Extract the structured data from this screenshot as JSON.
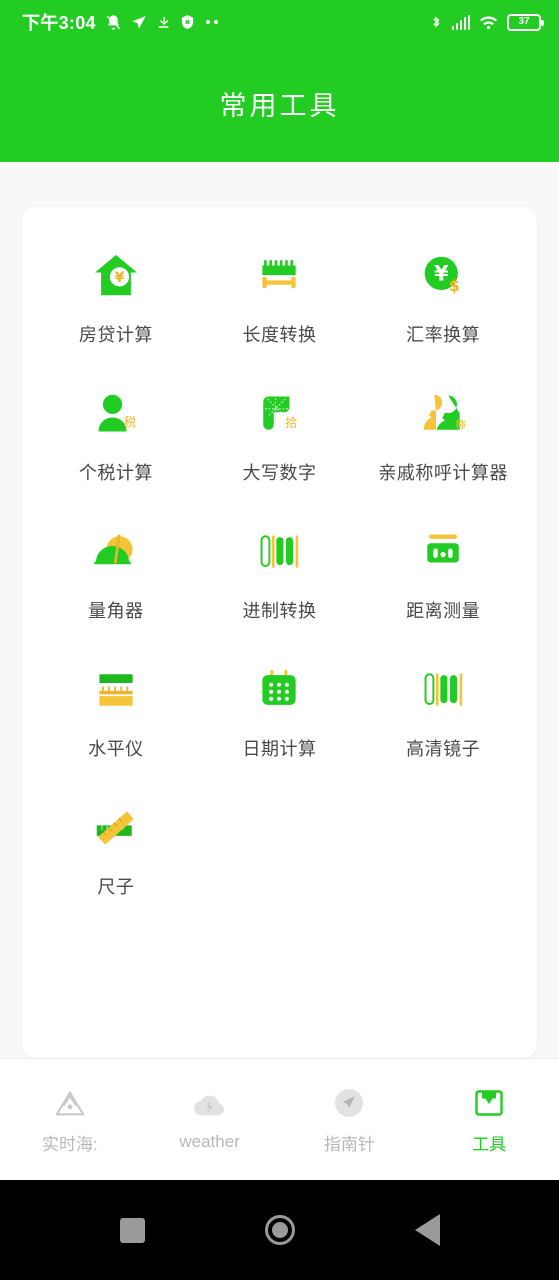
{
  "statusbar": {
    "time": "下午3:04",
    "left_icons": [
      "mute-bell-icon",
      "location-send-icon",
      "download-icon",
      "shield-icon",
      "more-dots-icon"
    ],
    "right_icons": [
      "bluetooth-icon",
      "cellular-signal-icon",
      "wifi-icon"
    ],
    "battery_level": "37"
  },
  "header": {
    "title": "常用工具"
  },
  "colors": {
    "green": "#22cc22",
    "green_dark": "#1eb91e",
    "yellow": "#f5c43a",
    "yellow_dark": "#f0b429",
    "label": "#4a4a4a",
    "inactive": "#b8b8b8",
    "bg": "#f7f8f7"
  },
  "tools": [
    {
      "label": "房贷计算",
      "icon": "house-yuan-icon"
    },
    {
      "label": "长度转换",
      "icon": "ruler-length-icon"
    },
    {
      "label": "汇率换算",
      "icon": "currency-exchange-icon"
    },
    {
      "label": "个税计算",
      "icon": "person-tax-icon"
    },
    {
      "label": "大写数字",
      "icon": "capital-number-icon"
    },
    {
      "label": "亲戚称呼计算器",
      "icon": "relatives-icon"
    },
    {
      "label": "量角器",
      "icon": "protractor-icon"
    },
    {
      "label": "进制转换",
      "icon": "barcode-bars-icon"
    },
    {
      "label": "距离测量",
      "icon": "distance-measure-icon"
    },
    {
      "label": "水平仪",
      "icon": "spirit-level-icon"
    },
    {
      "label": "日期计算",
      "icon": "calendar-icon"
    },
    {
      "label": "高清镜子",
      "icon": "mirror-bars-icon"
    },
    {
      "label": "尺子",
      "icon": "ruler-cross-icon"
    }
  ],
  "tabbar": [
    {
      "label": "实时海:",
      "icon": "mountain-icon",
      "active": false
    },
    {
      "label": "weather",
      "icon": "cloud-lightning-icon",
      "active": false
    },
    {
      "label": "指南针",
      "icon": "compass-icon",
      "active": false
    },
    {
      "label": "工具",
      "icon": "toolbox-icon",
      "active": true
    }
  ],
  "navbar": {
    "recents": "square-icon",
    "home": "circle-icon",
    "back": "triangle-back-icon"
  }
}
